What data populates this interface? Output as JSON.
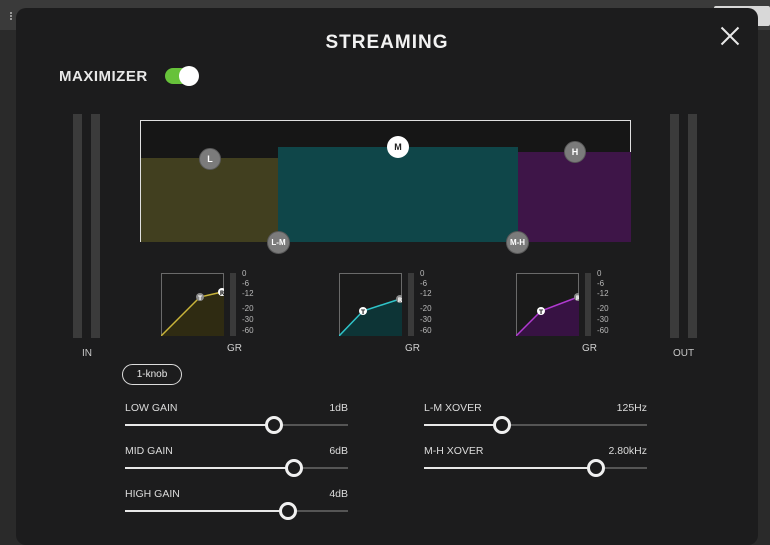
{
  "dialog": {
    "title": "STREAMING"
  },
  "maximizer": {
    "label": "MAXIMIZER",
    "enabled": true,
    "toggle_color": "#67c23a"
  },
  "meters": {
    "in_label": "IN",
    "out_label": "OUT"
  },
  "eq": {
    "bands": [
      {
        "id": "L",
        "label": "L",
        "color": "#413f1f"
      },
      {
        "id": "M",
        "label": "M",
        "color": "#0f4649"
      },
      {
        "id": "H",
        "label": "H",
        "color": "#3e1548"
      }
    ],
    "crossovers": [
      {
        "id": "L-M",
        "label": "L-M"
      },
      {
        "id": "M-H",
        "label": "M-H"
      }
    ]
  },
  "compressors": {
    "scale": [
      "0",
      "-6",
      "-12",
      "-20",
      "-30",
      "-60"
    ],
    "gr_label": "GR",
    "threshold_marker": "T",
    "ratio_marker": "R",
    "colors": {
      "low": "#c9b43a",
      "mid": "#2fc3c8",
      "high": "#b03ad0"
    }
  },
  "mode_button": {
    "label": "1-knob"
  },
  "sliders": {
    "low_gain": {
      "label": "LOW GAIN",
      "value": "1dB",
      "fraction": 0.67
    },
    "mid_gain": {
      "label": "MID GAIN",
      "value": "6dB",
      "fraction": 0.76
    },
    "high_gain": {
      "label": "HIGH GAIN",
      "value": "4dB",
      "fraction": 0.73
    },
    "lm_xover": {
      "label": "L-M XOVER",
      "value": "125Hz",
      "fraction": 0.35
    },
    "mh_xover": {
      "label": "M-H XOVER",
      "value": "2.80kHz",
      "fraction": 0.77
    }
  }
}
